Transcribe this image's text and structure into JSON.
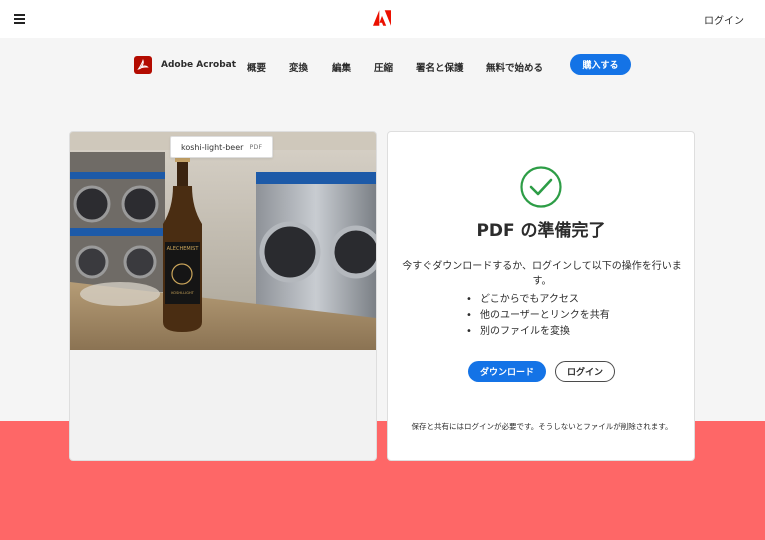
{
  "header": {
    "login_label": "ログイン"
  },
  "nav": {
    "brand": "Adobe Acrobat",
    "items": [
      "概要",
      "変換",
      "編集",
      "圧縮",
      "署名と保護",
      "無料で始める"
    ],
    "buy_label": "購入する"
  },
  "file": {
    "name": "koshi-light-beer",
    "ext": "PDF"
  },
  "result": {
    "title": "PDF の準備完了",
    "description": "今すぐダウンロードするか、ログインして以下の操作を行います。",
    "features": [
      "どこからでもアクセス",
      "他のユーザーとリンクを共有",
      "別のファイルを変換"
    ],
    "download_label": "ダウンロード",
    "login_label": "ログイン",
    "note": "保存と共有にはログインが必要です。そうしないとファイルが削除されます。"
  },
  "photo": {
    "bottle_label_top": "ALECHEMIST",
    "bottle_label_bottom": "KOSHI-LIGHT"
  },
  "colors": {
    "accent": "#1473e6",
    "adobe_red": "#eb1000",
    "success": "#2d9d46",
    "band": "#fe6767"
  }
}
